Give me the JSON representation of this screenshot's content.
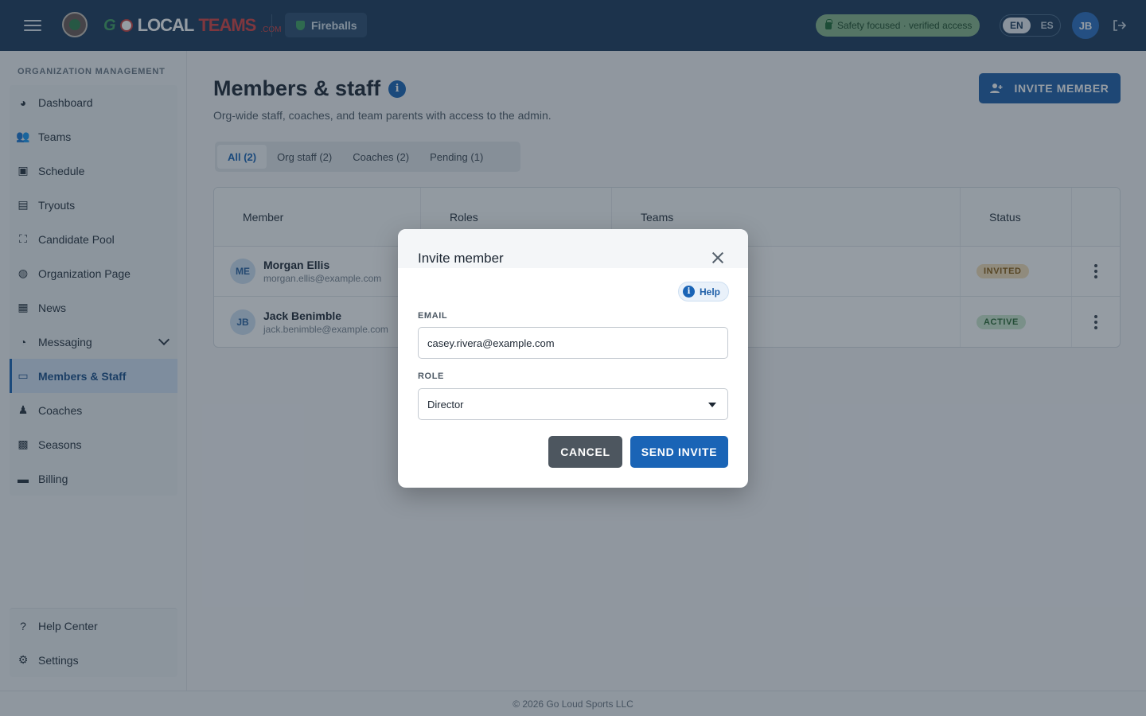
{
  "header": {
    "brand_prefix": "G",
    "brand_local": "LOCAL",
    "brand_teams": "TEAMS",
    "brand_com": ".COM",
    "team_name": "Fireballs",
    "safety_text": "Safety focused · verified access",
    "lang_en": "EN",
    "lang_es": "ES",
    "user_initials": "JB"
  },
  "sidebar": {
    "section_title": "ORGANIZATION MANAGEMENT",
    "items": [
      {
        "label": "Dashboard",
        "icon": "dashboard-icon",
        "glyph": "◕"
      },
      {
        "label": "Teams",
        "icon": "teams-icon",
        "glyph": "👥"
      },
      {
        "label": "Schedule",
        "icon": "calendar-icon",
        "glyph": "▣"
      },
      {
        "label": "Tryouts",
        "icon": "clipboard-icon",
        "glyph": "▤"
      },
      {
        "label": "Candidate Pool",
        "icon": "candidate-pool-icon",
        "glyph": "⛶"
      },
      {
        "label": "Organization Page",
        "icon": "globe-icon",
        "glyph": "◍"
      },
      {
        "label": "News",
        "icon": "news-icon",
        "glyph": "▦"
      },
      {
        "label": "Messaging",
        "icon": "chat-icon",
        "glyph": "◔"
      },
      {
        "label": "Members & Staff",
        "icon": "id-card-icon",
        "glyph": "▭"
      },
      {
        "label": "Coaches",
        "icon": "person-icon",
        "glyph": "♟"
      },
      {
        "label": "Seasons",
        "icon": "seasons-icon",
        "glyph": "▩"
      },
      {
        "label": "Billing",
        "icon": "credit-card-icon",
        "glyph": "▬"
      }
    ],
    "bottom_items": [
      {
        "label": "Help Center",
        "icon": "help-icon",
        "glyph": "?"
      },
      {
        "label": "Settings",
        "icon": "gear-icon",
        "glyph": "⚙"
      }
    ]
  },
  "main": {
    "title": "Members & staff",
    "info_glyph": "i",
    "subtitle": "Org-wide staff, coaches, and team parents with access to the admin.",
    "invite_label": "INVITE MEMBER",
    "tabs": [
      {
        "label": "All (2)"
      },
      {
        "label": "Org staff (2)"
      },
      {
        "label": "Coaches (2)"
      },
      {
        "label": "Pending (1)"
      }
    ],
    "columns": [
      "Member",
      "Roles",
      "Teams",
      "Status"
    ],
    "rows": [
      {
        "initials": "ME",
        "name": "Morgan Ellis",
        "email": "morgan.ellis@example.com",
        "status": "INVITED"
      },
      {
        "initials": "JB",
        "name": "Jack Benimble",
        "email": "jack.benimble@example.com",
        "status": "ACTIVE"
      }
    ]
  },
  "footer": {
    "text": "© 2026 Go Loud Sports LLC"
  },
  "dialog": {
    "title": "Invite member",
    "help_label": "Help",
    "help_glyph": "i",
    "email_label": "EMAIL",
    "email_value": "casey.rivera@example.com",
    "role_label": "ROLE",
    "role_value": "Director",
    "cancel_label": "CANCEL",
    "send_label": "SEND INVITE"
  },
  "colors": {
    "header_bg": "#1b3a5c",
    "primary": "#1a64b6",
    "cancel_bg": "#4d565f"
  }
}
